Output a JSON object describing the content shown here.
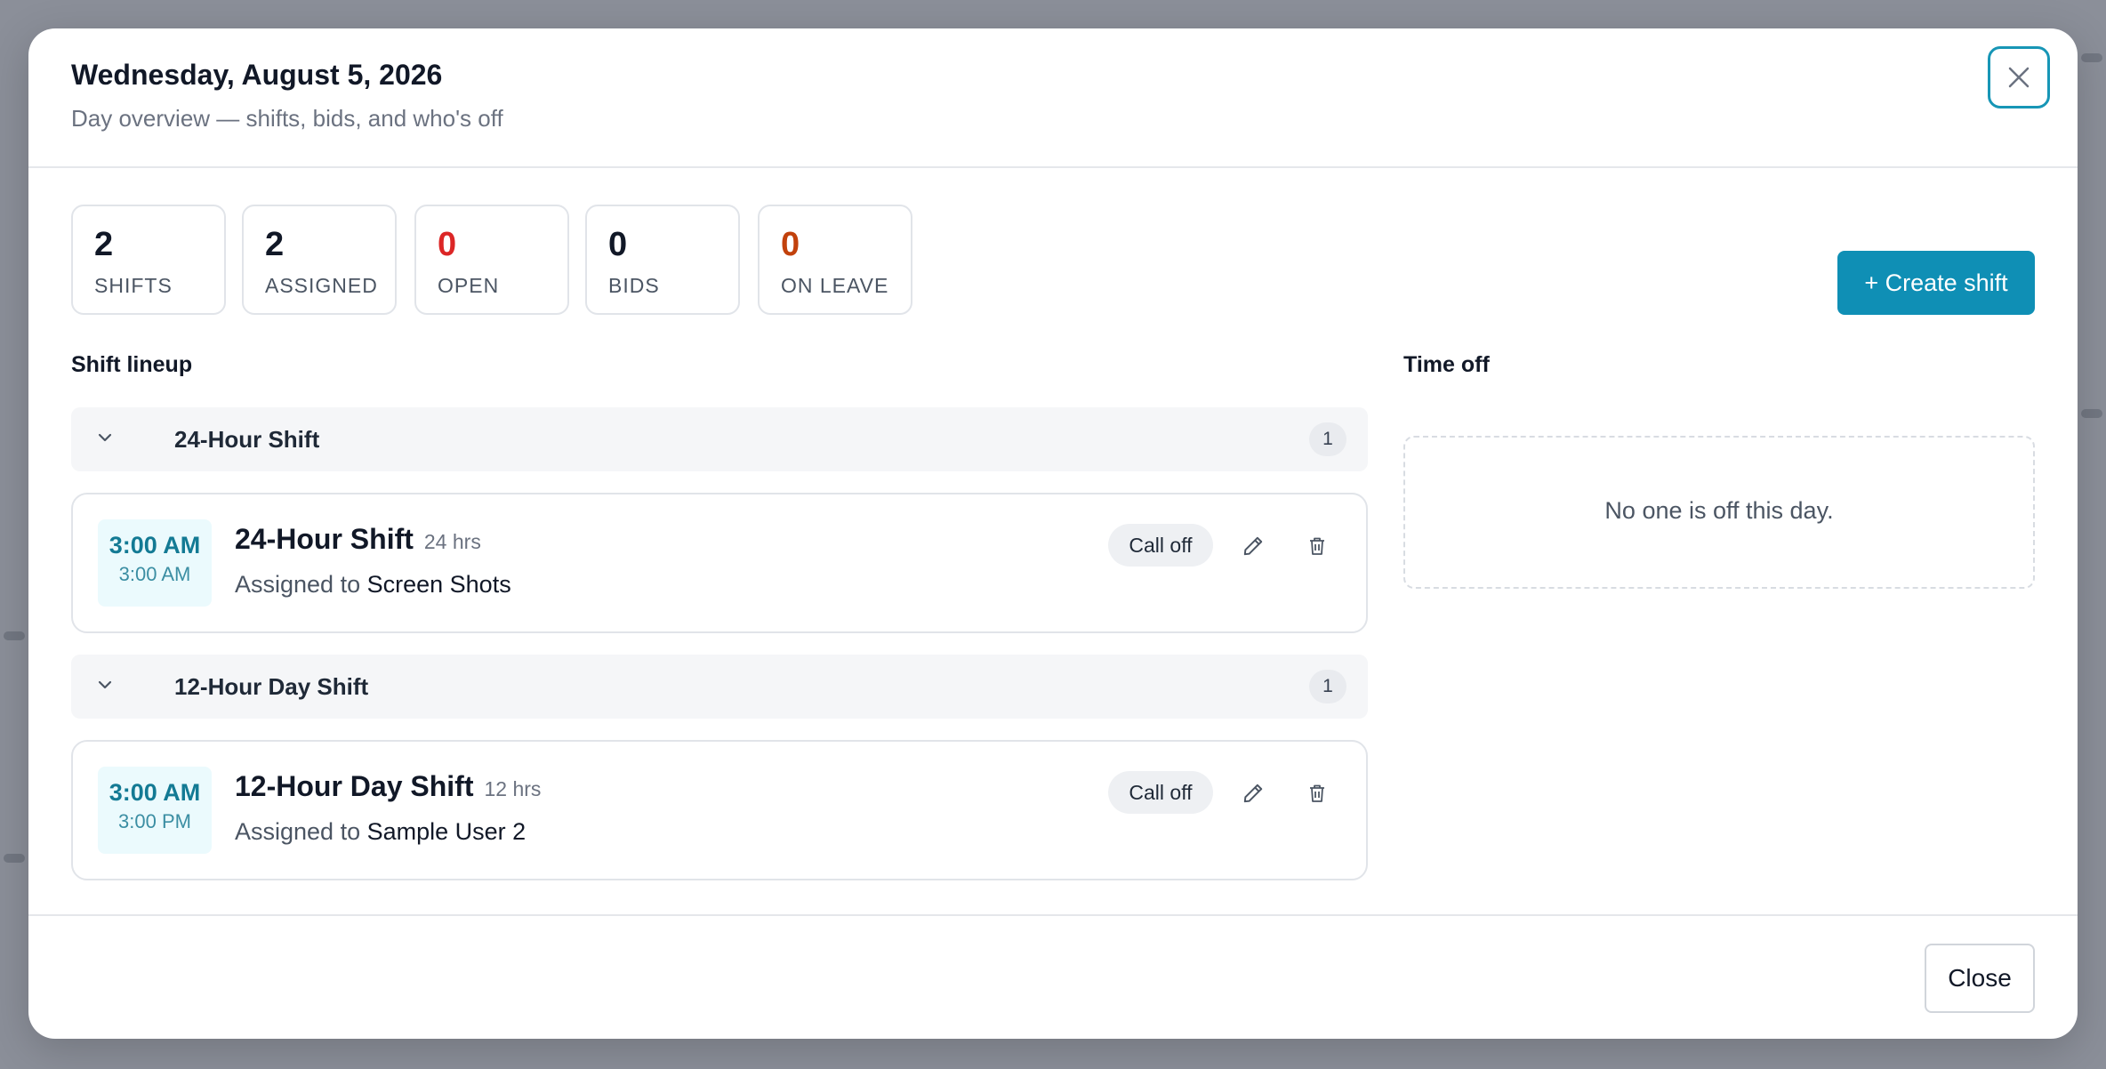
{
  "modal": {
    "title": "Wednesday, August 5, 2026",
    "subtitle": "Day overview — shifts, bids, and who's off"
  },
  "stats": [
    {
      "value": "2",
      "label": "SHIFTS",
      "color": "#111827"
    },
    {
      "value": "2",
      "label": "ASSIGNED",
      "color": "#111827"
    },
    {
      "value": "0",
      "label": "OPEN",
      "color": "#dc2626"
    },
    {
      "value": "0",
      "label": "BIDS",
      "color": "#111827"
    },
    {
      "value": "0",
      "label": "ON LEAVE",
      "color": "#c2410c"
    }
  ],
  "create_button": "+ Create shift",
  "lineup": {
    "title": "Shift lineup",
    "groups": [
      {
        "name": "24-Hour Shift",
        "count": "1",
        "shift": {
          "start": "3:00 AM",
          "end": "3:00 AM",
          "name": "24-Hour Shift",
          "hours": "24 hrs",
          "assigned_prefix": "Assigned to",
          "assignee": "Screen Shots",
          "call_off": "Call off"
        }
      },
      {
        "name": "12-Hour Day Shift",
        "count": "1",
        "shift": {
          "start": "3:00 AM",
          "end": "3:00 PM",
          "name": "12-Hour Day Shift",
          "hours": "12 hrs",
          "assigned_prefix": "Assigned to",
          "assignee": "Sample User 2",
          "call_off": "Call off"
        }
      }
    ]
  },
  "time_off": {
    "title": "Time off",
    "empty_message": "No one is off this day."
  },
  "footer": {
    "close_label": "Close"
  },
  "colors": {
    "accent": "#0f8fb5",
    "open": "#dc2626",
    "on_leave": "#c2410c"
  }
}
